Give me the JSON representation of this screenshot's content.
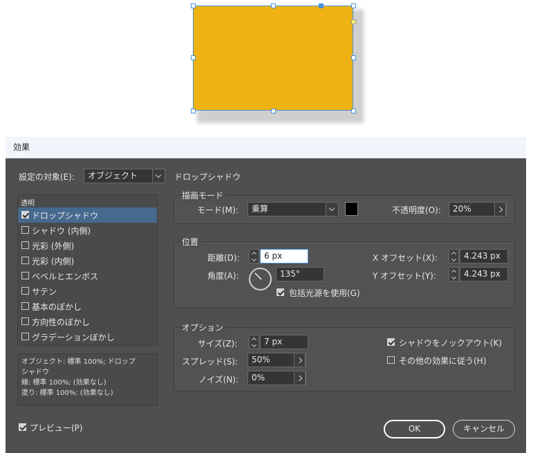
{
  "dialog": {
    "title": "効果",
    "target_label": "設定の対象(E):",
    "target_value": "オブジェクト",
    "section_header": "ドロップシャドウ",
    "preview_label": "プレビュー(P)",
    "ok_label": "OK",
    "cancel_label": "キャンセル"
  },
  "effects_list": {
    "category": "透明",
    "items": [
      {
        "label": "ドロップシャドウ",
        "checked": true
      },
      {
        "label": "シャドウ (内側)",
        "checked": false
      },
      {
        "label": "光彩 (外側)",
        "checked": false
      },
      {
        "label": "光彩 (内側)",
        "checked": false
      },
      {
        "label": "ベベルとエンボス",
        "checked": false
      },
      {
        "label": "サテン",
        "checked": false
      },
      {
        "label": "基本のぼかし",
        "checked": false
      },
      {
        "label": "方向性のぼかし",
        "checked": false
      },
      {
        "label": "グラデーションぼかし",
        "checked": false
      }
    ]
  },
  "summary": {
    "line1": "オブジェクト: 標準 100%; ドロップ",
    "line2": "シャドウ",
    "line3": "線: 標準 100%; (効果なし)",
    "line4": "塗り: 標準 100%; (効果なし)"
  },
  "blend": {
    "group_title": "描画モード",
    "mode_label": "モード(M):",
    "mode_value": "乗算",
    "swatch_color": "#000000",
    "opacity_label": "不透明度(O):",
    "opacity_value": "20%"
  },
  "position": {
    "group_title": "位置",
    "distance_label": "距離(D):",
    "distance_value": "6 px",
    "angle_label": "角度(A):",
    "angle_value": "135°",
    "angle_degrees": 135,
    "global_light_label": "包括光源を使用(G)",
    "x_offset_label": "X オフセット(X):",
    "x_offset_value": "4.243 px",
    "y_offset_label": "Y オフセット(Y):",
    "y_offset_value": "4.243 px"
  },
  "options": {
    "group_title": "オプション",
    "size_label": "サイズ(Z):",
    "size_value": "7 px",
    "spread_label": "スプレッド(S):",
    "spread_value": "50%",
    "noise_label": "ノイズ(N):",
    "noise_value": "0%",
    "knockout_label": "シャドウをノックアウト(K)",
    "honor_others_label": "その他の効果に従う(H)"
  },
  "colors": {
    "object_fill": "#EEB312",
    "selection_blue": "#4a90d9",
    "dialog_bg": "#4f4f4f",
    "selected_row": "#46698e"
  }
}
